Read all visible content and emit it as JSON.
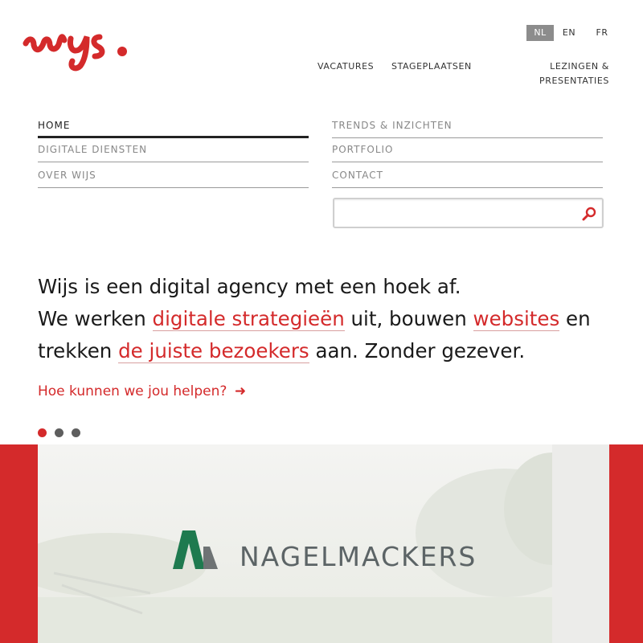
{
  "brand": {
    "logo_text": "wijs.",
    "accent": "#d42a2b"
  },
  "languages": [
    {
      "label": "NL",
      "active": true
    },
    {
      "label": "EN",
      "active": false
    },
    {
      "label": "FR",
      "active": false
    }
  ],
  "topnav": {
    "vacatures": "VACATURES",
    "stageplaatsen": "STAGEPLAATSEN",
    "lezingen_line1": "LEZINGEN &",
    "lezingen_line2": "PRESENTATIES"
  },
  "mainnav": {
    "home": "HOME",
    "digitale_diensten": "DIGITALE DIENSTEN",
    "over_wijs": "OVER WIJS",
    "trends": "TRENDS & INZICHTEN",
    "portfolio": "PORTFOLIO",
    "contact": "CONTACT"
  },
  "search": {
    "value": "",
    "placeholder": "",
    "icon": "search-icon"
  },
  "hero": {
    "line1": "Wijs is een digital agency met een hoek af.",
    "p2_before": "We werken ",
    "link_strategie": "digitale strategieën",
    "p2_mid": " uit, bouwen ",
    "link_websites": "websites",
    "p2_after": " en",
    "p3_before": "trekken ",
    "link_bezoekers": "de juiste bezoekers",
    "p3_after": " aan. Zonder gezever."
  },
  "cta": {
    "label": "Hoe kunnen we jou helpen?",
    "arrow": "➜"
  },
  "slider": {
    "count": 3,
    "active_index": 0
  },
  "banner": {
    "client_name": "NAGELMACKERS",
    "logo_colors": [
      "#1e7a4f",
      "#6e7374"
    ]
  }
}
